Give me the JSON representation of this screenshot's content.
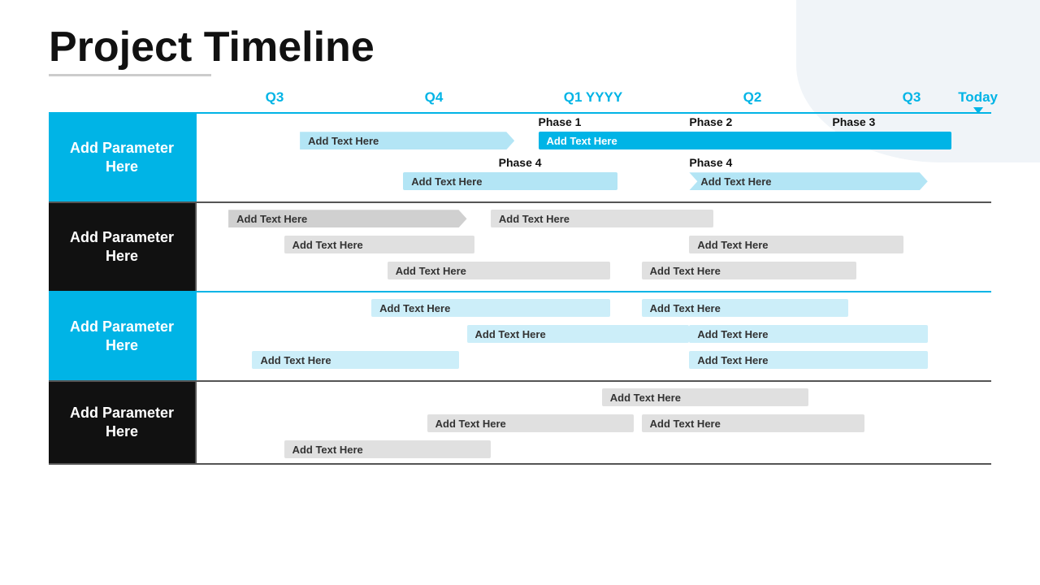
{
  "title": "Project Timeline",
  "quarters": [
    "Q3",
    "Q4",
    "Q1 YYYY",
    "Q2",
    "Q3"
  ],
  "today_label": "Today",
  "rows": [
    {
      "label": "Add Parameter Here",
      "label_style": "blue",
      "phases": [
        {
          "label": "Phase 1",
          "left_pct": 45,
          "width_pct": 18
        },
        {
          "label": "Phase 2",
          "left_pct": 63,
          "width_pct": 18
        },
        {
          "label": "Phase 3",
          "left_pct": 81,
          "width_pct": 16
        }
      ],
      "bars": [
        {
          "text": "Add Text Here",
          "left_pct": 14,
          "width_pct": 28,
          "style": "light-blue-arrow",
          "row": 1
        },
        {
          "text": "Add Text Here",
          "left_pct": 45,
          "width_pct": 38,
          "style": "blue-solid",
          "row": 1
        },
        {
          "text": "Phase 4",
          "left_pct": 40,
          "width_pct": 10,
          "style": "label-only",
          "row": 2
        },
        {
          "text": "Add Text Here",
          "left_pct": 26,
          "width_pct": 28,
          "style": "light-blue-bar",
          "row": 2
        },
        {
          "text": "Phase 4",
          "left_pct": 63,
          "width_pct": 10,
          "style": "label-only",
          "row": 2
        },
        {
          "text": "Add Text Here",
          "left_pct": 63,
          "width_pct": 30,
          "style": "light-blue-arrow-right",
          "row": 2
        }
      ]
    },
    {
      "label": "Add Parameter Here",
      "label_style": "black",
      "bars": [
        {
          "text": "Add Text Here",
          "left_pct": 5,
          "width_pct": 30,
          "style": "gray-arrow",
          "row": 1
        },
        {
          "text": "Add Text Here",
          "left_pct": 38,
          "width_pct": 28,
          "style": "light-gray-bar",
          "row": 1
        },
        {
          "text": "Add Text Here",
          "left_pct": 12,
          "width_pct": 24,
          "style": "light-gray-bar",
          "row": 2
        },
        {
          "text": "Add Text Here",
          "left_pct": 63,
          "width_pct": 26,
          "style": "light-gray-bar",
          "row": 2
        },
        {
          "text": "Add Text Here",
          "left_pct": 25,
          "width_pct": 28,
          "style": "light-gray-bar",
          "row": 3
        },
        {
          "text": "Add Text Here",
          "left_pct": 57,
          "width_pct": 26,
          "style": "light-gray-bar",
          "row": 3
        }
      ]
    },
    {
      "label": "Add Parameter Here",
      "label_style": "blue",
      "bars": [
        {
          "text": "Add Text Here",
          "left_pct": 23,
          "width_pct": 30,
          "style": "lighter-blue-bar",
          "row": 1
        },
        {
          "text": "Add Text Here",
          "left_pct": 57,
          "width_pct": 26,
          "style": "lighter-blue-bar",
          "row": 1
        },
        {
          "text": "Add Text Here",
          "left_pct": 35,
          "width_pct": 28,
          "style": "lighter-blue-bar",
          "row": 2
        },
        {
          "text": "Add Text Here",
          "left_pct": 63,
          "width_pct": 30,
          "style": "lighter-blue-bar",
          "row": 2
        },
        {
          "text": "Add Text Here",
          "left_pct": 8,
          "width_pct": 26,
          "style": "lighter-blue-bar",
          "row": 3
        },
        {
          "text": "Add Text Here",
          "left_pct": 63,
          "width_pct": 30,
          "style": "lighter-blue-bar",
          "row": 3
        }
      ]
    },
    {
      "label": "Add Parameter Here",
      "label_style": "black",
      "bars": [
        {
          "text": "Add Text Here",
          "left_pct": 52,
          "width_pct": 25,
          "style": "light-gray-bar",
          "row": 1
        },
        {
          "text": "Add Text Here",
          "left_pct": 30,
          "width_pct": 26,
          "style": "light-gray-bar",
          "row": 2
        },
        {
          "text": "Add Text Here",
          "left_pct": 57,
          "width_pct": 28,
          "style": "light-gray-bar",
          "row": 2
        },
        {
          "text": "Add Text Here",
          "left_pct": 12,
          "width_pct": 26,
          "style": "light-gray-bar",
          "row": 3
        }
      ]
    }
  ]
}
